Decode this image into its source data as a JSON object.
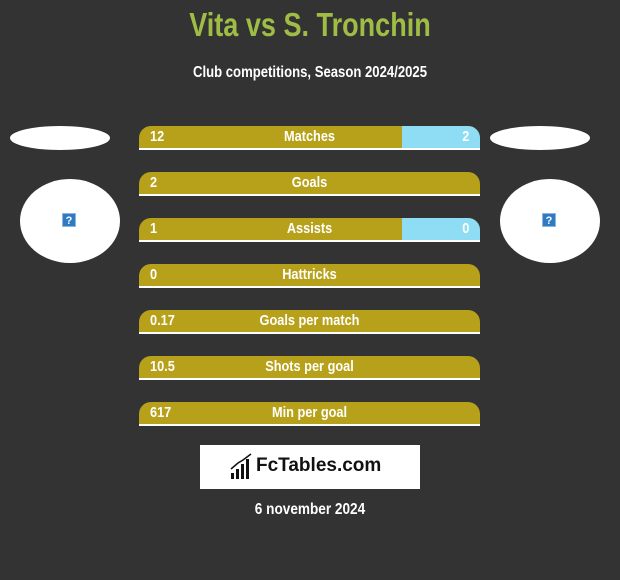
{
  "header": {
    "title": "Vita vs S. Tronchin",
    "subtitle": "Club competitions, Season 2024/2025"
  },
  "players": {
    "left": {
      "icon": "question-icon",
      "glyph": "?"
    },
    "right": {
      "icon": "question-icon",
      "glyph": "?"
    }
  },
  "colors": {
    "background": "#333333",
    "title": "#9fbd45",
    "left_bar": "#b8a11a",
    "right_bar": "#8fdcf5"
  },
  "stats": [
    {
      "label": "Matches",
      "left": "12",
      "right": "2",
      "right_fraction": 0.23
    },
    {
      "label": "Goals",
      "left": "2",
      "right": "",
      "right_fraction": 0
    },
    {
      "label": "Assists",
      "left": "1",
      "right": "0",
      "right_fraction": 0.23
    },
    {
      "label": "Hattricks",
      "left": "0",
      "right": "",
      "right_fraction": 0
    },
    {
      "label": "Goals per match",
      "left": "0.17",
      "right": "",
      "right_fraction": 0
    },
    {
      "label": "Shots per goal",
      "left": "10.5",
      "right": "",
      "right_fraction": 0
    },
    {
      "label": "Min per goal",
      "left": "617",
      "right": "",
      "right_fraction": 0
    }
  ],
  "footer": {
    "logo_text": "FcTables.com",
    "date": "6 november 2024"
  }
}
